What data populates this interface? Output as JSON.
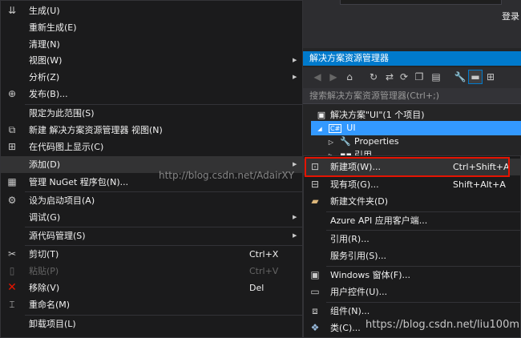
{
  "header": {
    "login": "登录"
  },
  "solution_explorer": {
    "title": "解决方案资源管理器",
    "search_placeholder": "搜索解决方案资源管理器(Ctrl+;)",
    "tree": [
      {
        "label": "解决方案\"UI\"(1 个项目)",
        "arrow": ""
      },
      {
        "label": "UI",
        "arrow": "◢"
      },
      {
        "label": "Properties",
        "arrow": "▷"
      },
      {
        "label": "引用",
        "arrow": "▷"
      }
    ]
  },
  "context_menu": {
    "items": [
      {
        "label": "生成(U)",
        "shortcut": ""
      },
      {
        "label": "重新生成(E)",
        "shortcut": ""
      },
      {
        "label": "清理(N)",
        "shortcut": ""
      },
      {
        "label": "视图(W)",
        "shortcut": ""
      },
      {
        "label": "分析(Z)",
        "shortcut": ""
      },
      {
        "label": "发布(B)...",
        "shortcut": ""
      },
      {
        "label": "限定为此范围(S)",
        "shortcut": ""
      },
      {
        "label": "新建 解决方案资源管理器 视图(N)",
        "shortcut": ""
      },
      {
        "label": "在代码图上显示(C)",
        "shortcut": ""
      },
      {
        "label": "添加(D)",
        "shortcut": ""
      },
      {
        "label": "管理 NuGet 程序包(N)...",
        "shortcut": ""
      },
      {
        "label": "设为启动项目(A)",
        "shortcut": ""
      },
      {
        "label": "调试(G)",
        "shortcut": ""
      },
      {
        "label": "源代码管理(S)",
        "shortcut": ""
      },
      {
        "label": "剪切(T)",
        "shortcut": "Ctrl+X"
      },
      {
        "label": "粘贴(P)",
        "shortcut": "Ctrl+V"
      },
      {
        "label": "移除(V)",
        "shortcut": "Del"
      },
      {
        "label": "重命名(M)",
        "shortcut": ""
      },
      {
        "label": "卸载项目(L)",
        "shortcut": ""
      }
    ]
  },
  "add_submenu": {
    "items": [
      {
        "label": "新建项(W)...",
        "shortcut": "Ctrl+Shift+A"
      },
      {
        "label": "现有项(G)...",
        "shortcut": "Shift+Alt+A"
      },
      {
        "label": "新建文件夹(D)",
        "shortcut": ""
      },
      {
        "label": "Azure API 应用客户端...",
        "shortcut": ""
      },
      {
        "label": "引用(R)...",
        "shortcut": ""
      },
      {
        "label": "服务引用(S)...",
        "shortcut": ""
      },
      {
        "label": "Windows 窗体(F)...",
        "shortcut": ""
      },
      {
        "label": "用户控件(U)...",
        "shortcut": ""
      },
      {
        "label": "组件(N)...",
        "shortcut": ""
      },
      {
        "label": "类(C)...",
        "shortcut": ""
      }
    ]
  },
  "watermarks": {
    "center": "http://blog.csdn.net/AdairXY",
    "bottom": "https://blog.csdn.net/liu100m"
  },
  "colors": {
    "accent": "#007acc",
    "highlight_box": "#e51400",
    "selection": "#3399ff"
  }
}
